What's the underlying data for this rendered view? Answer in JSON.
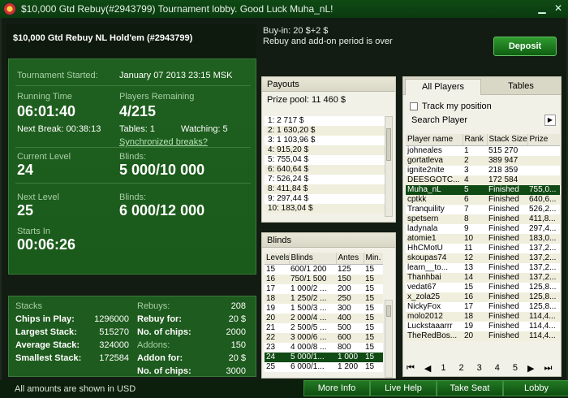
{
  "window": {
    "title": "$10,000 Gtd Rebuy(#2943799) Tournament lobby. Good Luck Muha_nL!"
  },
  "header": {
    "title": "$10,000 Gtd Rebuy NL Hold'em (#2943799)"
  },
  "info": {
    "buyin": "Buy-in: 20 $+2 $",
    "rebuy_status": "Rebuy and add-on period is over"
  },
  "deposit_label": "Deposit",
  "tournament": {
    "started_label": "Tournament Started:",
    "started_value": "January 07 2013  23:15 MSK",
    "running_label": "Running Time",
    "running_value": "06:01:40",
    "players_label": "Players Remaining",
    "players_value": "4/215",
    "next_break": "Next Break: 00:38:13",
    "tables": "Tables: 1",
    "watching": "Watching: 5",
    "sync_link": "Synchronized breaks?",
    "current_level_label": "Current Level",
    "current_level_value": "24",
    "blinds_label": "Blinds:",
    "current_blinds": "5 000/10 000",
    "next_level_label": "Next Level",
    "next_level_value": "25",
    "next_blinds": "6 000/12 000",
    "starts_in_label": "Starts In",
    "starts_in_value": "00:06:26"
  },
  "stats": {
    "stacks_label": "Stacks",
    "chips_in_play_label": "Chips in Play:",
    "chips_in_play": "1296000",
    "largest_label": "Largest Stack:",
    "largest": "515270",
    "average_label": "Average Stack:",
    "average": "324000",
    "smallest_label": "Smallest Stack:",
    "smallest": "172584",
    "rebuys_label": "Rebuys:",
    "rebuys": "208",
    "rebuy_for_label": "Rebuy for:",
    "rebuy_for": "20 $",
    "rebuy_chips_label": "No. of chips:",
    "rebuy_chips": "2000",
    "addons_label": "Addons:",
    "addons": "150",
    "addon_for_label": "Addon for:",
    "addon_for": "20 $",
    "addon_chips_label": "No. of chips:",
    "addon_chips": "3000"
  },
  "payouts": {
    "title": "Payouts",
    "prize_pool": "Prize pool: 11 460 $",
    "rows": [
      "1: 2 717 $",
      "2: 1 630,20 $",
      "3: 1 103,96 $",
      "4: 915,20 $",
      "5: 755,04 $",
      "6: 640,64 $",
      "7: 526,24 $",
      "8: 411,84 $",
      "9: 297,44 $",
      "10: 183,04 $"
    ]
  },
  "blinds": {
    "title": "Blinds",
    "headers": [
      "Levels",
      "Blinds",
      "Antes",
      "Min."
    ],
    "rows": [
      [
        "15",
        "600/1 200",
        "125",
        "15"
      ],
      [
        "16",
        "750/1 500",
        "150",
        "15"
      ],
      [
        "17",
        "1 000/2 ...",
        "200",
        "15"
      ],
      [
        "18",
        "1 250/2 ...",
        "250",
        "15"
      ],
      [
        "19",
        "1 500/3 ...",
        "300",
        "15"
      ],
      [
        "20",
        "2 000/4 ...",
        "400",
        "15"
      ],
      [
        "21",
        "2 500/5 ...",
        "500",
        "15"
      ],
      [
        "22",
        "3 000/6 ...",
        "600",
        "15"
      ],
      [
        "23",
        "4 000/8 ...",
        "800",
        "15"
      ],
      [
        "24",
        "5 000/1...",
        "1 000",
        "15"
      ],
      [
        "25",
        "6 000/1...",
        "1 200",
        "15"
      ]
    ]
  },
  "players": {
    "tabs": [
      "All Players",
      "Tables"
    ],
    "track_label": "Track my position",
    "search_label": "Search Player",
    "headers": [
      "Player name",
      "Rank",
      "Stack Size",
      "Prize"
    ],
    "rows": [
      [
        "johneales",
        "1",
        "515 270",
        ""
      ],
      [
        "gortatleva",
        "2",
        "389 947",
        ""
      ],
      [
        "ignite2nite",
        "3",
        "218 359",
        ""
      ],
      [
        "DEESGOTC...",
        "4",
        "172 584",
        ""
      ],
      [
        "Muha_nL",
        "5",
        "Finished",
        "755,0..."
      ],
      [
        "cptkk",
        "6",
        "Finished",
        "640,6..."
      ],
      [
        "Tranquility",
        "7",
        "Finished",
        "526,2..."
      ],
      [
        "spetsern",
        "8",
        "Finished",
        "411,8..."
      ],
      [
        "ladynala",
        "9",
        "Finished",
        "297,4..."
      ],
      [
        "atomie1",
        "10",
        "Finished",
        "183,0..."
      ],
      [
        "HhCMotU",
        "11",
        "Finished",
        "137,2..."
      ],
      [
        "skoupas74",
        "12",
        "Finished",
        "137,2..."
      ],
      [
        "learn__to...",
        "13",
        "Finished",
        "137,2..."
      ],
      [
        "Thanhbai",
        "14",
        "Finished",
        "137,2..."
      ],
      [
        "vedat67",
        "15",
        "Finished",
        "125,8..."
      ],
      [
        "x_zola25",
        "16",
        "Finished",
        "125,8..."
      ],
      [
        "NickyFox",
        "17",
        "Finished",
        "125,8..."
      ],
      [
        "molo2012",
        "18",
        "Finished",
        "114,4..."
      ],
      [
        "Luckstaaarrr",
        "19",
        "Finished",
        "114,4..."
      ],
      [
        "TheRedBos...",
        "20",
        "Finished",
        "114,4..."
      ]
    ],
    "pages": [
      "1",
      "2",
      "3",
      "4",
      "5"
    ]
  },
  "footer": {
    "note": "All amounts are shown in USD",
    "more_info": "More Info",
    "live_help": "Live Help",
    "take_seat": "Take Seat",
    "lobby": "Lobby"
  }
}
